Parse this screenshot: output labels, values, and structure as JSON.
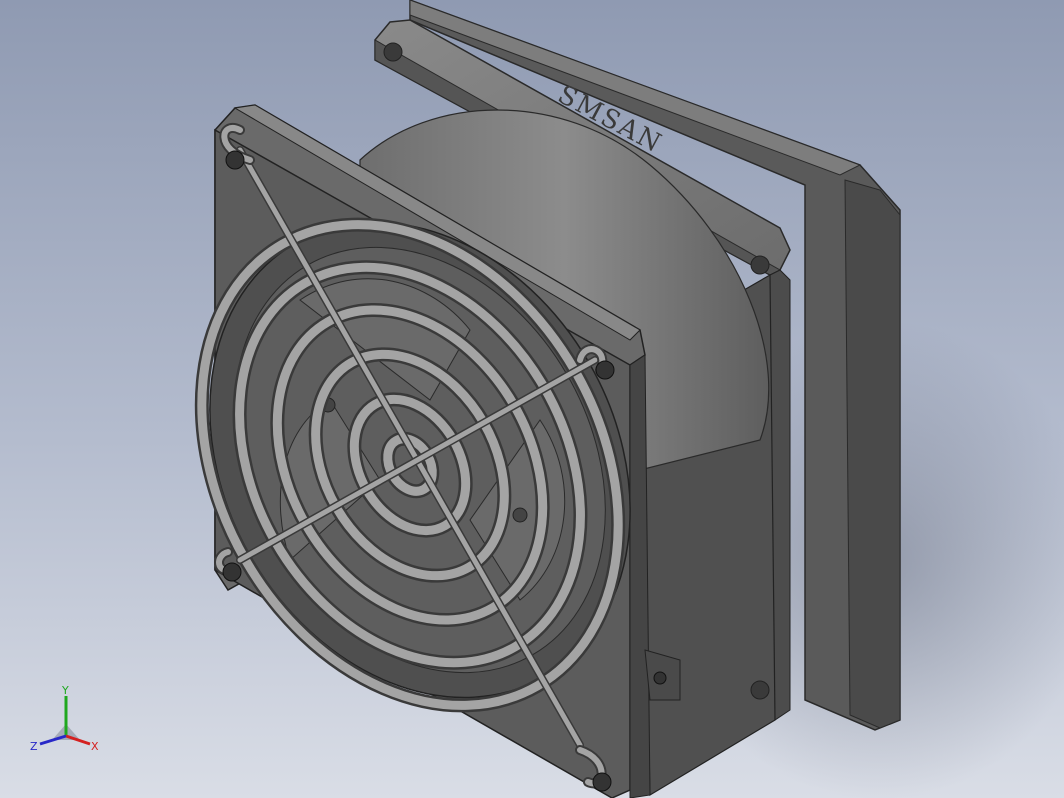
{
  "model": {
    "brand_text": "SMSAN",
    "description_icon": "axial-fan-with-wire-guard"
  },
  "triad": {
    "x_label": "X",
    "y_label": "Y",
    "z_label": "Z",
    "x_color": "#d42020",
    "y_color": "#1fa81f",
    "z_color": "#2828c8"
  },
  "colors": {
    "background_top": "#8f9ab2",
    "background_bottom": "#d9dde6",
    "housing": "#6b6b6b",
    "guard": "#9a9a9a"
  }
}
